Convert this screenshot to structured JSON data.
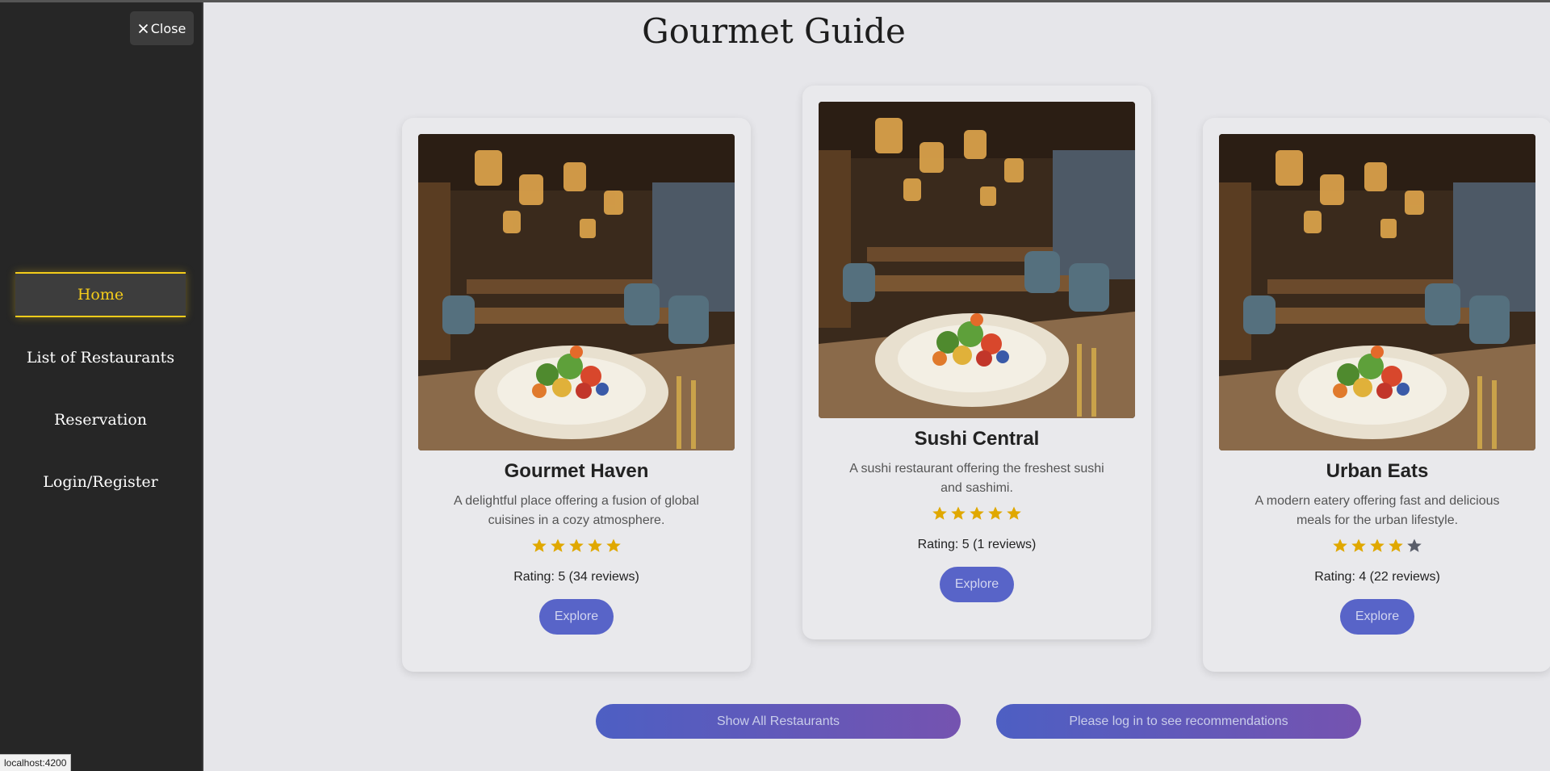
{
  "sidebar": {
    "close_label": "Close",
    "items": [
      {
        "label": "Home",
        "active": true
      },
      {
        "label": "List of Restaurants",
        "active": false
      },
      {
        "label": "Reservation",
        "active": false
      },
      {
        "label": "Login/Register",
        "active": false
      }
    ],
    "accent_color": "#f4cc1a"
  },
  "main": {
    "title": "Gourmet Guide",
    "restaurants": [
      {
        "name": "Gourmet Haven",
        "description": "A delightful place offering a fusion of global cuisines in a cozy atmosphere.",
        "stars": 5,
        "rating_text": "Rating: 5 (34 reviews)",
        "button_label": "Explore"
      },
      {
        "name": "Sushi Central",
        "description": "A sushi restaurant offering the freshest sushi and sashimi.",
        "stars": 5,
        "rating_text": "Rating: 5 (1 reviews)",
        "button_label": "Explore"
      },
      {
        "name": "Urban Eats",
        "description": "A modern eatery offering fast and delicious meals for the urban lifestyle.",
        "stars": 4,
        "rating_text": "Rating: 4 (22 reviews)",
        "button_label": "Explore"
      }
    ],
    "show_all_label": "Show All Restaurants",
    "recommend_label": "Please log in to see recommendations",
    "star_filled_color": "#e0a800",
    "star_empty_color": "#5a5e6a",
    "button_color": "#5864c8"
  },
  "status_bar": {
    "url": "localhost:4200"
  }
}
